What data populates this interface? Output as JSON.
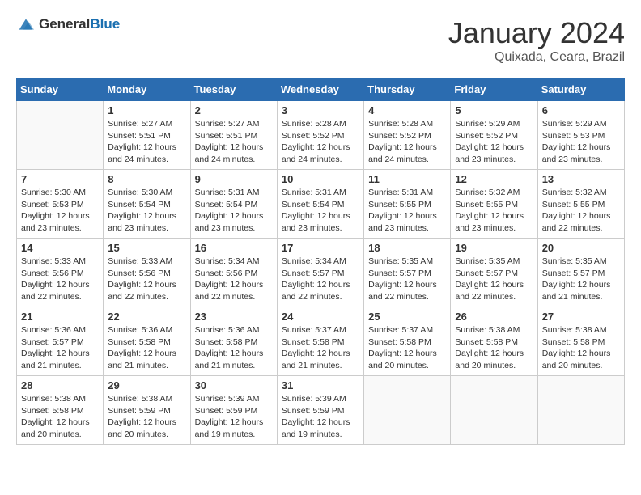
{
  "logo": {
    "general": "General",
    "blue": "Blue"
  },
  "title": {
    "month_year": "January 2024",
    "location": "Quixada, Ceara, Brazil"
  },
  "headers": [
    "Sunday",
    "Monday",
    "Tuesday",
    "Wednesday",
    "Thursday",
    "Friday",
    "Saturday"
  ],
  "weeks": [
    [
      {
        "day": "",
        "info": ""
      },
      {
        "day": "1",
        "info": "Sunrise: 5:27 AM\nSunset: 5:51 PM\nDaylight: 12 hours\nand 24 minutes."
      },
      {
        "day": "2",
        "info": "Sunrise: 5:27 AM\nSunset: 5:51 PM\nDaylight: 12 hours\nand 24 minutes."
      },
      {
        "day": "3",
        "info": "Sunrise: 5:28 AM\nSunset: 5:52 PM\nDaylight: 12 hours\nand 24 minutes."
      },
      {
        "day": "4",
        "info": "Sunrise: 5:28 AM\nSunset: 5:52 PM\nDaylight: 12 hours\nand 24 minutes."
      },
      {
        "day": "5",
        "info": "Sunrise: 5:29 AM\nSunset: 5:52 PM\nDaylight: 12 hours\nand 23 minutes."
      },
      {
        "day": "6",
        "info": "Sunrise: 5:29 AM\nSunset: 5:53 PM\nDaylight: 12 hours\nand 23 minutes."
      }
    ],
    [
      {
        "day": "7",
        "info": "Sunrise: 5:30 AM\nSunset: 5:53 PM\nDaylight: 12 hours\nand 23 minutes."
      },
      {
        "day": "8",
        "info": "Sunrise: 5:30 AM\nSunset: 5:54 PM\nDaylight: 12 hours\nand 23 minutes."
      },
      {
        "day": "9",
        "info": "Sunrise: 5:31 AM\nSunset: 5:54 PM\nDaylight: 12 hours\nand 23 minutes."
      },
      {
        "day": "10",
        "info": "Sunrise: 5:31 AM\nSunset: 5:54 PM\nDaylight: 12 hours\nand 23 minutes."
      },
      {
        "day": "11",
        "info": "Sunrise: 5:31 AM\nSunset: 5:55 PM\nDaylight: 12 hours\nand 23 minutes."
      },
      {
        "day": "12",
        "info": "Sunrise: 5:32 AM\nSunset: 5:55 PM\nDaylight: 12 hours\nand 23 minutes."
      },
      {
        "day": "13",
        "info": "Sunrise: 5:32 AM\nSunset: 5:55 PM\nDaylight: 12 hours\nand 22 minutes."
      }
    ],
    [
      {
        "day": "14",
        "info": "Sunrise: 5:33 AM\nSunset: 5:56 PM\nDaylight: 12 hours\nand 22 minutes."
      },
      {
        "day": "15",
        "info": "Sunrise: 5:33 AM\nSunset: 5:56 PM\nDaylight: 12 hours\nand 22 minutes."
      },
      {
        "day": "16",
        "info": "Sunrise: 5:34 AM\nSunset: 5:56 PM\nDaylight: 12 hours\nand 22 minutes."
      },
      {
        "day": "17",
        "info": "Sunrise: 5:34 AM\nSunset: 5:57 PM\nDaylight: 12 hours\nand 22 minutes."
      },
      {
        "day": "18",
        "info": "Sunrise: 5:35 AM\nSunset: 5:57 PM\nDaylight: 12 hours\nand 22 minutes."
      },
      {
        "day": "19",
        "info": "Sunrise: 5:35 AM\nSunset: 5:57 PM\nDaylight: 12 hours\nand 22 minutes."
      },
      {
        "day": "20",
        "info": "Sunrise: 5:35 AM\nSunset: 5:57 PM\nDaylight: 12 hours\nand 21 minutes."
      }
    ],
    [
      {
        "day": "21",
        "info": "Sunrise: 5:36 AM\nSunset: 5:57 PM\nDaylight: 12 hours\nand 21 minutes."
      },
      {
        "day": "22",
        "info": "Sunrise: 5:36 AM\nSunset: 5:58 PM\nDaylight: 12 hours\nand 21 minutes."
      },
      {
        "day": "23",
        "info": "Sunrise: 5:36 AM\nSunset: 5:58 PM\nDaylight: 12 hours\nand 21 minutes."
      },
      {
        "day": "24",
        "info": "Sunrise: 5:37 AM\nSunset: 5:58 PM\nDaylight: 12 hours\nand 21 minutes."
      },
      {
        "day": "25",
        "info": "Sunrise: 5:37 AM\nSunset: 5:58 PM\nDaylight: 12 hours\nand 20 minutes."
      },
      {
        "day": "26",
        "info": "Sunrise: 5:38 AM\nSunset: 5:58 PM\nDaylight: 12 hours\nand 20 minutes."
      },
      {
        "day": "27",
        "info": "Sunrise: 5:38 AM\nSunset: 5:58 PM\nDaylight: 12 hours\nand 20 minutes."
      }
    ],
    [
      {
        "day": "28",
        "info": "Sunrise: 5:38 AM\nSunset: 5:58 PM\nDaylight: 12 hours\nand 20 minutes."
      },
      {
        "day": "29",
        "info": "Sunrise: 5:38 AM\nSunset: 5:59 PM\nDaylight: 12 hours\nand 20 minutes."
      },
      {
        "day": "30",
        "info": "Sunrise: 5:39 AM\nSunset: 5:59 PM\nDaylight: 12 hours\nand 19 minutes."
      },
      {
        "day": "31",
        "info": "Sunrise: 5:39 AM\nSunset: 5:59 PM\nDaylight: 12 hours\nand 19 minutes."
      },
      {
        "day": "",
        "info": ""
      },
      {
        "day": "",
        "info": ""
      },
      {
        "day": "",
        "info": ""
      }
    ]
  ]
}
